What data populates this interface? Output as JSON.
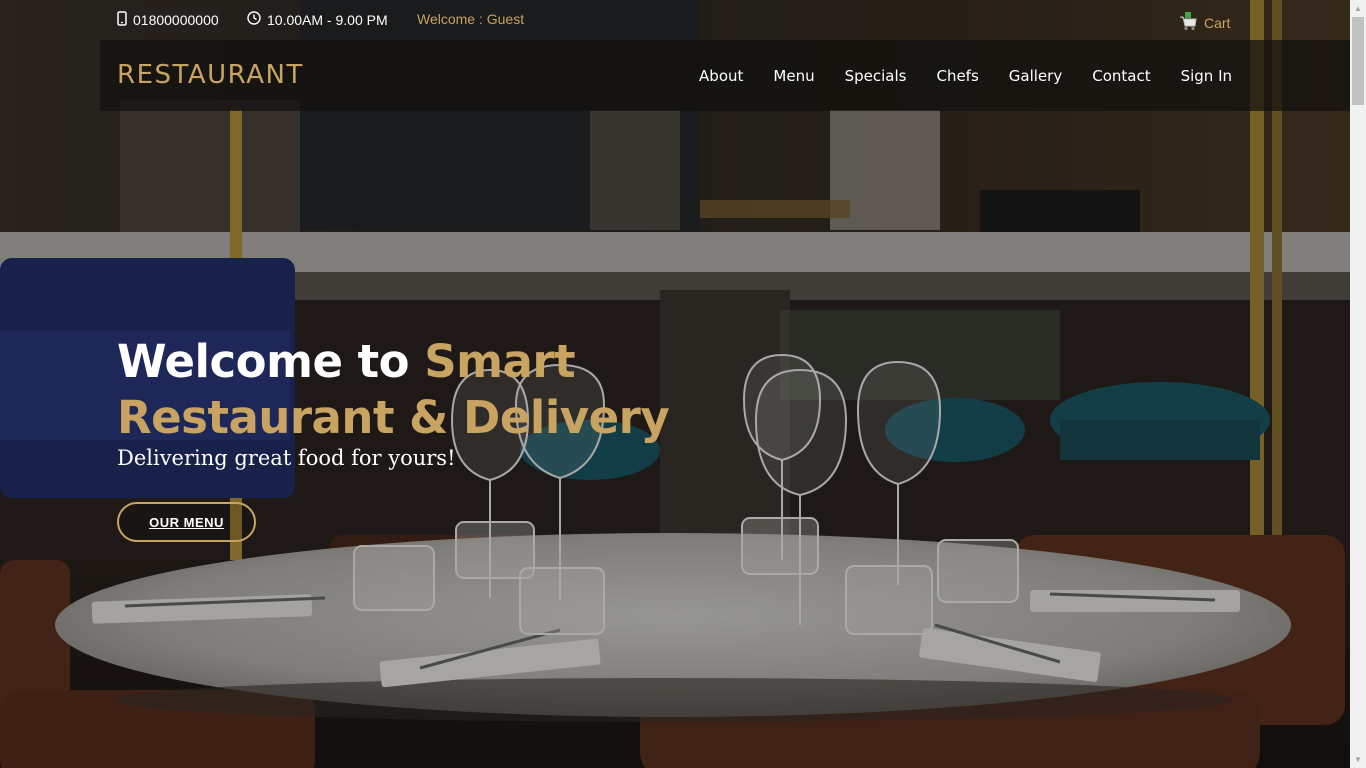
{
  "topbar": {
    "phone": "01800000000",
    "hours": "10.00AM - 9.00 PM",
    "welcome": "Welcome : Guest",
    "cart_label": "Cart",
    "phone_icon": "phone-icon",
    "clock_icon": "clock-icon",
    "cart_icon": "shopping-cart-icon"
  },
  "nav": {
    "brand": "RESTAURANT",
    "items": [
      {
        "label": "About"
      },
      {
        "label": "Menu"
      },
      {
        "label": "Specials"
      },
      {
        "label": "Chefs"
      },
      {
        "label": "Gallery"
      },
      {
        "label": "Contact"
      },
      {
        "label": "Sign In"
      }
    ]
  },
  "hero": {
    "title_part1": "Welcome to ",
    "title_part2": "Smart",
    "title_line2": "Restaurant & Delivery",
    "subtitle": "Delivering great food for yours!",
    "button_label": "OUR MENU"
  },
  "colors": {
    "accent_gold": "#c8a361",
    "nav_bg": "#12100e",
    "text_white": "#ffffff"
  }
}
